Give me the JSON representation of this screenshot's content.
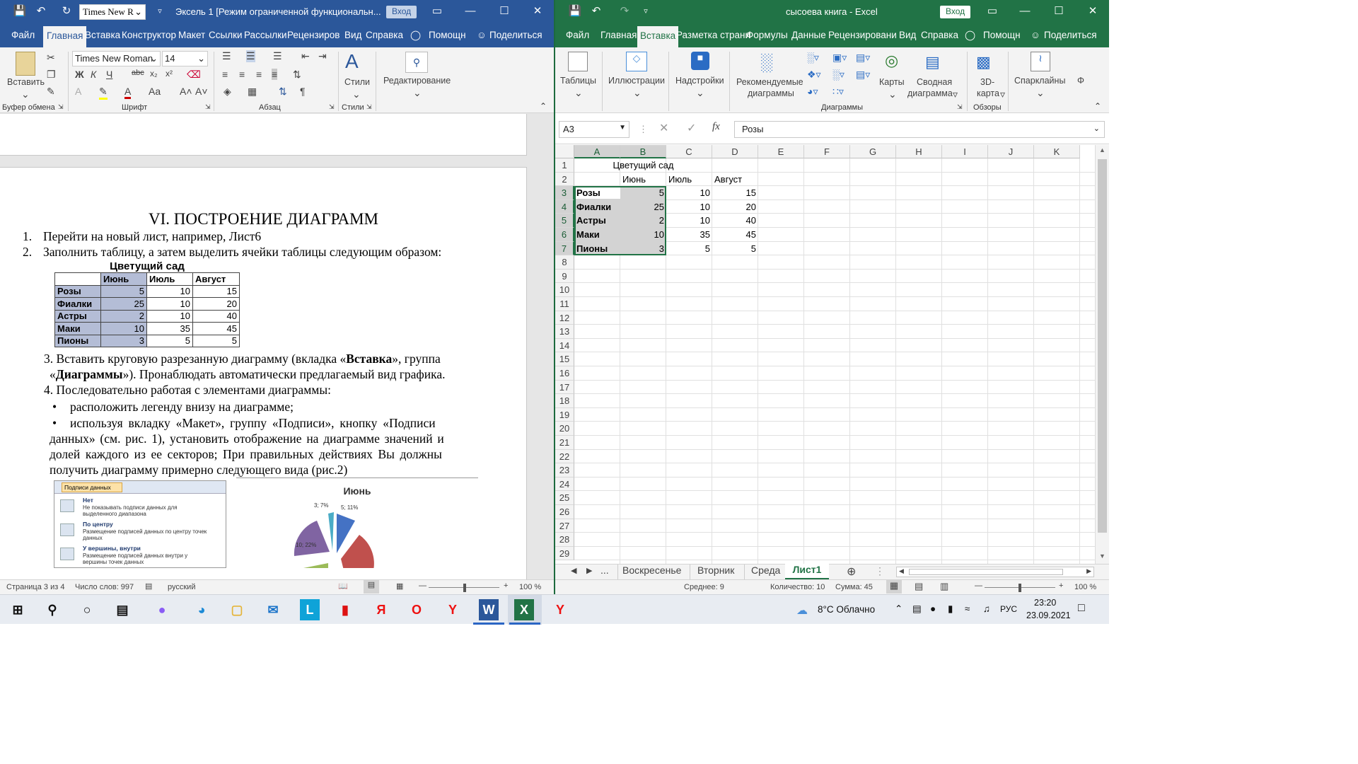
{
  "word": {
    "font_quick": "Times New R",
    "title": "Эксель 1 [Режим ограниченной функциональн...",
    "login_label": "Вход",
    "tabs": [
      "Файл",
      "Главная",
      "Вставка",
      "Конструктор",
      "Макет",
      "Ссылки",
      "Рассылки",
      "Рецензиров",
      "Вид",
      "Справка",
      "Помощн",
      "Поделиться"
    ],
    "ribbon": {
      "paste_label": "Вставить",
      "font_name": "Times New Roman",
      "font_size": "14",
      "styles_label": "Стили",
      "editing_label": "Редактирование",
      "groups": [
        "Буфер обмена",
        "Шрифт",
        "Абзац",
        "Стили"
      ]
    },
    "doc": {
      "heading": "VI. ПОСТРОЕНИЕ ДИАГРАММ",
      "items": [
        {
          "num": "1.",
          "text": "Перейти на новый лист, например, Лист6"
        },
        {
          "num": "2.",
          "text": "Заполнить таблицу, а затем выделить ячейки таблицы следующим образом:"
        }
      ],
      "table": {
        "title": "Цветущий сад",
        "headers": [
          "",
          "Июнь",
          "Июль",
          "Август"
        ],
        "rows": [
          [
            "Розы",
            "5",
            "10",
            "15"
          ],
          [
            "Фиалки",
            "25",
            "10",
            "20"
          ],
          [
            "Астры",
            "2",
            "10",
            "40"
          ],
          [
            "Маки",
            "10",
            "35",
            "45"
          ],
          [
            "Пионы",
            "3",
            "5",
            "5"
          ]
        ]
      },
      "item3_a": "3.   Вставить круговую разрезанную диаграмму (вкладка «",
      "item3_b": "Вставка",
      "item3_c": "», группа",
      "item3_d": "«",
      "item3_e": "Диаграммы",
      "item3_f": "»). Пронаблюдать автоматически предлагаемый вид графика.",
      "item4": "4.     Последовательно работая с элементами диаграммы:",
      "bullet1": "расположить легенду внизу на диаграмме;",
      "bullet2_l1": "используя вкладку «Макет», группу «Подписи», кнопку «Подписи",
      "bullet2_l2": "данных» (см. рис. 1), установить отображение на диаграмме значений и",
      "bullet2_l3": "долей каждого из ее секторов; При правильных действиях Вы должны",
      "bullet2_l4": "получить диаграмму примерно следующего вида (рис.2)",
      "menu": {
        "button": "Подписи данных",
        "items": [
          {
            "title": "Нет",
            "desc1": "Не показывать подписи данных для",
            "desc2": "выделенного диапазона"
          },
          {
            "title": "По центру",
            "desc1": "Размещение подписей данных по центру точек",
            "desc2": "данных"
          },
          {
            "title": "У вершины, внутри",
            "desc1": "Размещение подписей данных внутри у",
            "desc2": "вершины точек данных"
          }
        ]
      },
      "pie": {
        "title": "Июнь",
        "labels": [
          "3; 7%",
          "5; 11%",
          "10; 22%"
        ]
      }
    },
    "status": {
      "page": "Страница 3 из 4",
      "words": "Число слов: 997",
      "lang": "русский",
      "zoom": "100 %"
    }
  },
  "excel": {
    "title": "сысоева книга  -  Excel",
    "login_label": "Вход",
    "tabs": [
      "Файл",
      "Главная",
      "Вставка",
      "Разметка страни",
      "Формулы",
      "Данные",
      "Рецензировани",
      "Вид",
      "Справка",
      "Помощн",
      "Поделиться"
    ],
    "ribbon": {
      "tables": "Таблицы",
      "illustrations": "Иллюстрации",
      "addins": "Надстройки",
      "recommended_l1": "Рекомендуемые",
      "recommended_l2": "диаграммы",
      "maps": "Карты",
      "pivot_l1": "Сводная",
      "pivot_l2": "диаграмма",
      "map3d_l1": "3D-",
      "map3d_l2": "карта",
      "sparklines": "Спарклайны",
      "group_charts": "Диаграммы",
      "group_tours": "Обзоры"
    },
    "name_box": "A3",
    "formula": "Розы",
    "columns": [
      "A",
      "B",
      "C",
      "D",
      "E",
      "F",
      "G",
      "H",
      "I",
      "J",
      "K"
    ],
    "rows": [
      "1",
      "2",
      "3",
      "4",
      "5",
      "6",
      "7",
      "8",
      "9",
      "10",
      "11",
      "12",
      "13",
      "14",
      "15",
      "16",
      "17",
      "18",
      "19",
      "20",
      "21",
      "22",
      "23",
      "24",
      "25",
      "26",
      "27",
      "28",
      "29"
    ],
    "cells": {
      "title": "Цветущий сад",
      "headers": [
        "Июнь",
        "Июль",
        "Август"
      ],
      "data": [
        [
          "Розы",
          "5",
          "10",
          "15"
        ],
        [
          "Фиалки",
          "25",
          "10",
          "20"
        ],
        [
          "Астры",
          "2",
          "10",
          "40"
        ],
        [
          "Маки",
          "10",
          "35",
          "45"
        ],
        [
          "Пионы",
          "3",
          "5",
          "5"
        ]
      ]
    },
    "sheets": [
      "Воскресенье",
      "Вторник",
      "Среда",
      "Лист1"
    ],
    "ellipsis": "...",
    "status": {
      "avg": "Среднее: 9",
      "count": "Количество: 10",
      "sum": "Сумма: 45",
      "zoom": "100 %"
    }
  },
  "taskbar": {
    "weather": "8°C  Облачно",
    "lang": "РУС",
    "time": "23:20",
    "date": "23.09.2021"
  },
  "colors": {
    "word": "#2b579a",
    "excel": "#217346",
    "selection": "#b4bdd6"
  }
}
